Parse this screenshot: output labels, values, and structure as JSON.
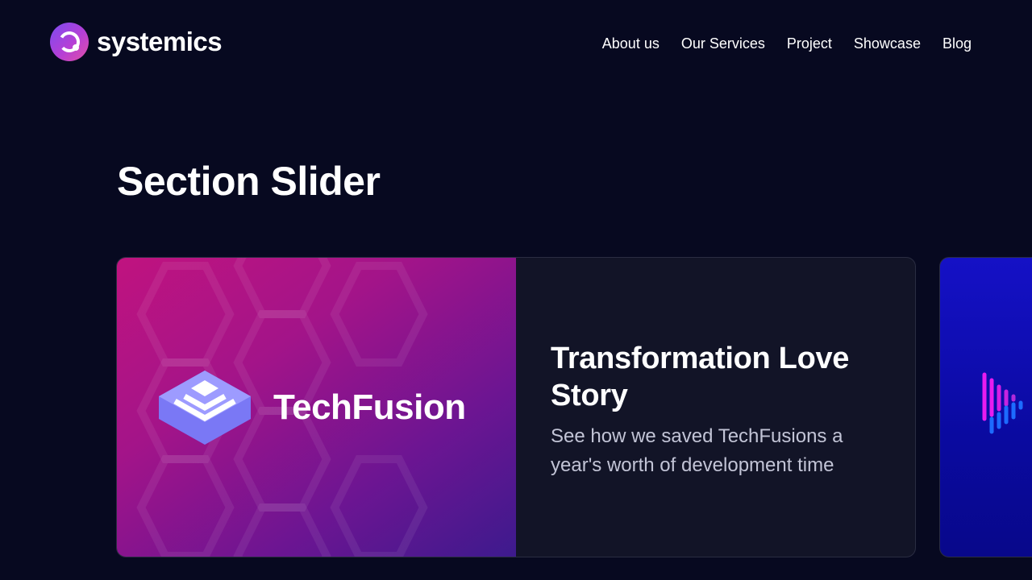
{
  "header": {
    "logo_text": "systemics",
    "nav": [
      {
        "label": "About us"
      },
      {
        "label": "Our Services"
      },
      {
        "label": "Project"
      },
      {
        "label": "Showcase"
      },
      {
        "label": "Blog"
      }
    ]
  },
  "section": {
    "title": "Section Slider"
  },
  "slides": [
    {
      "brand": "TechFusion",
      "title": "Transformation Love Story",
      "description": "See how we saved TechFusions a year's worth of development time"
    }
  ],
  "colors": {
    "background": "#070920",
    "card": "#121427",
    "accent_gradient_start": "#c0137f",
    "accent_gradient_end": "#3d1a8d",
    "next_card": "#1511c6"
  },
  "icons": {
    "logo": "ring-logo-icon",
    "brand": "stacked-layers-icon",
    "next_card": "waveform-bars-icon"
  }
}
